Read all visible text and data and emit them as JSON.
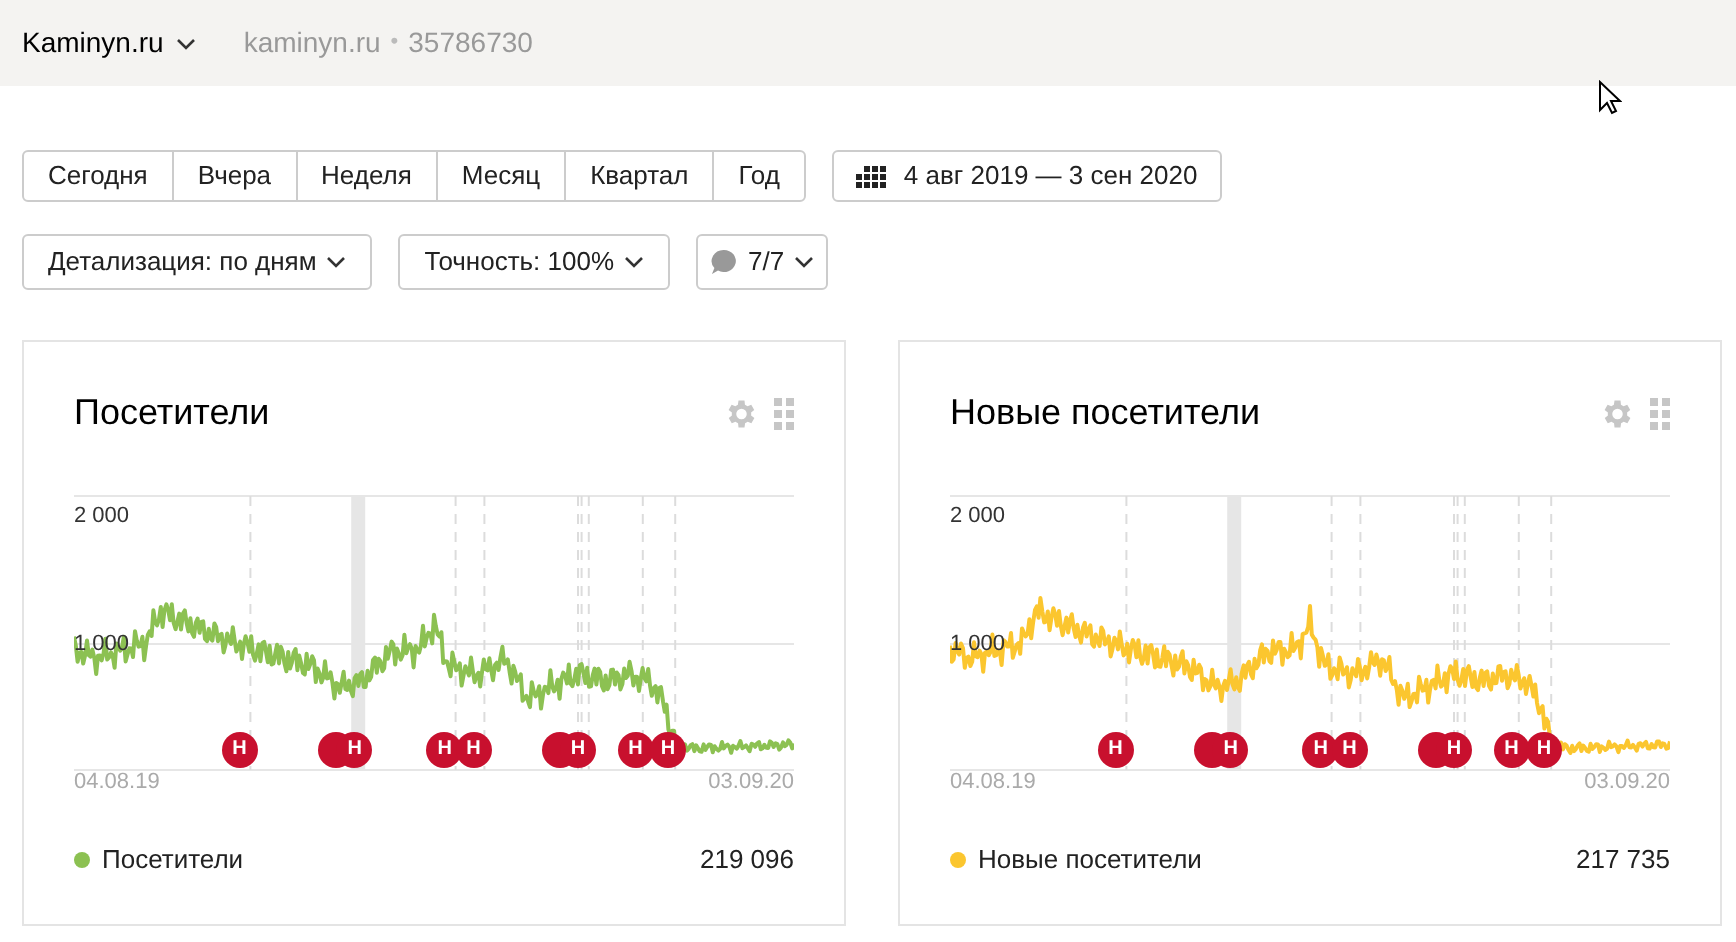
{
  "header": {
    "site": "Kaminyn.ru",
    "domain": "kaminyn.ru",
    "separator": "•",
    "counter": "35786730"
  },
  "periods": [
    {
      "label": "Сегодня",
      "selected": false
    },
    {
      "label": "Вчера",
      "selected": false
    },
    {
      "label": "Неделя",
      "selected": false
    },
    {
      "label": "Месяц",
      "selected": false
    },
    {
      "label": "Квартал",
      "selected": false
    },
    {
      "label": "Год",
      "selected": false
    }
  ],
  "date_range": "4 авг 2019 — 3 сен 2020",
  "filters": [
    {
      "kind": "dropdown",
      "label": "Детализация: по дням"
    },
    {
      "kind": "dropdown",
      "label": "Точность: 100%"
    },
    {
      "kind": "notes",
      "label": "7/7"
    }
  ],
  "widgets": [
    {
      "title": "Посетители",
      "y_labels": [
        "2 000",
        "1 000"
      ],
      "x_start": "04.08.19",
      "x_end": "03.09.20",
      "markers": [
        {
          "label": "Н",
          "stacked": false
        },
        {
          "label": "Н",
          "stacked": true
        },
        {
          "label": "Н",
          "stacked": false
        },
        {
          "label": "Н",
          "stacked": false
        },
        {
          "label": "Н",
          "stacked": true
        },
        {
          "label": "Н",
          "stacked": false
        },
        {
          "label": "Н",
          "stacked": false
        }
      ],
      "legend": {
        "name": "Посетители",
        "color": "#8cc152",
        "total": "219 096"
      }
    },
    {
      "title": "Новые посетители",
      "y_labels": [
        "2 000",
        "1 000"
      ],
      "x_start": "04.08.19",
      "x_end": "03.09.20",
      "markers": [
        {
          "label": "Н",
          "stacked": false
        },
        {
          "label": "Н",
          "stacked": true
        },
        {
          "label": "Н",
          "stacked": false
        },
        {
          "label": "Н",
          "stacked": false
        },
        {
          "label": "Н",
          "stacked": true
        },
        {
          "label": "Н",
          "stacked": false
        },
        {
          "label": "Н",
          "stacked": false
        }
      ],
      "legend": {
        "name": "Новые посетители",
        "color": "#fbc62f",
        "total": "217 735"
      }
    }
  ]
}
